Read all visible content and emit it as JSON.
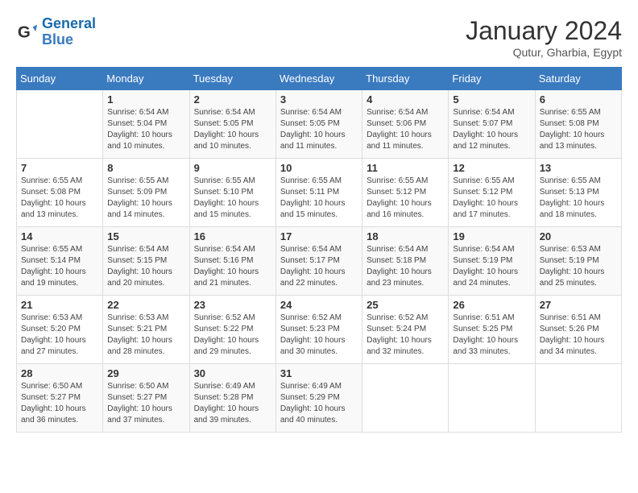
{
  "header": {
    "logo_line1": "General",
    "logo_line2": "Blue",
    "month": "January 2024",
    "location": "Qutur, Gharbia, Egypt"
  },
  "days_of_week": [
    "Sunday",
    "Monday",
    "Tuesday",
    "Wednesday",
    "Thursday",
    "Friday",
    "Saturday"
  ],
  "weeks": [
    [
      {
        "day": "",
        "sunrise": "",
        "sunset": "",
        "daylight": ""
      },
      {
        "day": "1",
        "sunrise": "Sunrise: 6:54 AM",
        "sunset": "Sunset: 5:04 PM",
        "daylight": "Daylight: 10 hours and 10 minutes."
      },
      {
        "day": "2",
        "sunrise": "Sunrise: 6:54 AM",
        "sunset": "Sunset: 5:05 PM",
        "daylight": "Daylight: 10 hours and 10 minutes."
      },
      {
        "day": "3",
        "sunrise": "Sunrise: 6:54 AM",
        "sunset": "Sunset: 5:05 PM",
        "daylight": "Daylight: 10 hours and 11 minutes."
      },
      {
        "day": "4",
        "sunrise": "Sunrise: 6:54 AM",
        "sunset": "Sunset: 5:06 PM",
        "daylight": "Daylight: 10 hours and 11 minutes."
      },
      {
        "day": "5",
        "sunrise": "Sunrise: 6:54 AM",
        "sunset": "Sunset: 5:07 PM",
        "daylight": "Daylight: 10 hours and 12 minutes."
      },
      {
        "day": "6",
        "sunrise": "Sunrise: 6:55 AM",
        "sunset": "Sunset: 5:08 PM",
        "daylight": "Daylight: 10 hours and 13 minutes."
      }
    ],
    [
      {
        "day": "7",
        "sunrise": "Sunrise: 6:55 AM",
        "sunset": "Sunset: 5:08 PM",
        "daylight": "Daylight: 10 hours and 13 minutes."
      },
      {
        "day": "8",
        "sunrise": "Sunrise: 6:55 AM",
        "sunset": "Sunset: 5:09 PM",
        "daylight": "Daylight: 10 hours and 14 minutes."
      },
      {
        "day": "9",
        "sunrise": "Sunrise: 6:55 AM",
        "sunset": "Sunset: 5:10 PM",
        "daylight": "Daylight: 10 hours and 15 minutes."
      },
      {
        "day": "10",
        "sunrise": "Sunrise: 6:55 AM",
        "sunset": "Sunset: 5:11 PM",
        "daylight": "Daylight: 10 hours and 15 minutes."
      },
      {
        "day": "11",
        "sunrise": "Sunrise: 6:55 AM",
        "sunset": "Sunset: 5:12 PM",
        "daylight": "Daylight: 10 hours and 16 minutes."
      },
      {
        "day": "12",
        "sunrise": "Sunrise: 6:55 AM",
        "sunset": "Sunset: 5:12 PM",
        "daylight": "Daylight: 10 hours and 17 minutes."
      },
      {
        "day": "13",
        "sunrise": "Sunrise: 6:55 AM",
        "sunset": "Sunset: 5:13 PM",
        "daylight": "Daylight: 10 hours and 18 minutes."
      }
    ],
    [
      {
        "day": "14",
        "sunrise": "Sunrise: 6:55 AM",
        "sunset": "Sunset: 5:14 PM",
        "daylight": "Daylight: 10 hours and 19 minutes."
      },
      {
        "day": "15",
        "sunrise": "Sunrise: 6:54 AM",
        "sunset": "Sunset: 5:15 PM",
        "daylight": "Daylight: 10 hours and 20 minutes."
      },
      {
        "day": "16",
        "sunrise": "Sunrise: 6:54 AM",
        "sunset": "Sunset: 5:16 PM",
        "daylight": "Daylight: 10 hours and 21 minutes."
      },
      {
        "day": "17",
        "sunrise": "Sunrise: 6:54 AM",
        "sunset": "Sunset: 5:17 PM",
        "daylight": "Daylight: 10 hours and 22 minutes."
      },
      {
        "day": "18",
        "sunrise": "Sunrise: 6:54 AM",
        "sunset": "Sunset: 5:18 PM",
        "daylight": "Daylight: 10 hours and 23 minutes."
      },
      {
        "day": "19",
        "sunrise": "Sunrise: 6:54 AM",
        "sunset": "Sunset: 5:19 PM",
        "daylight": "Daylight: 10 hours and 24 minutes."
      },
      {
        "day": "20",
        "sunrise": "Sunrise: 6:53 AM",
        "sunset": "Sunset: 5:19 PM",
        "daylight": "Daylight: 10 hours and 25 minutes."
      }
    ],
    [
      {
        "day": "21",
        "sunrise": "Sunrise: 6:53 AM",
        "sunset": "Sunset: 5:20 PM",
        "daylight": "Daylight: 10 hours and 27 minutes."
      },
      {
        "day": "22",
        "sunrise": "Sunrise: 6:53 AM",
        "sunset": "Sunset: 5:21 PM",
        "daylight": "Daylight: 10 hours and 28 minutes."
      },
      {
        "day": "23",
        "sunrise": "Sunrise: 6:52 AM",
        "sunset": "Sunset: 5:22 PM",
        "daylight": "Daylight: 10 hours and 29 minutes."
      },
      {
        "day": "24",
        "sunrise": "Sunrise: 6:52 AM",
        "sunset": "Sunset: 5:23 PM",
        "daylight": "Daylight: 10 hours and 30 minutes."
      },
      {
        "day": "25",
        "sunrise": "Sunrise: 6:52 AM",
        "sunset": "Sunset: 5:24 PM",
        "daylight": "Daylight: 10 hours and 32 minutes."
      },
      {
        "day": "26",
        "sunrise": "Sunrise: 6:51 AM",
        "sunset": "Sunset: 5:25 PM",
        "daylight": "Daylight: 10 hours and 33 minutes."
      },
      {
        "day": "27",
        "sunrise": "Sunrise: 6:51 AM",
        "sunset": "Sunset: 5:26 PM",
        "daylight": "Daylight: 10 hours and 34 minutes."
      }
    ],
    [
      {
        "day": "28",
        "sunrise": "Sunrise: 6:50 AM",
        "sunset": "Sunset: 5:27 PM",
        "daylight": "Daylight: 10 hours and 36 minutes."
      },
      {
        "day": "29",
        "sunrise": "Sunrise: 6:50 AM",
        "sunset": "Sunset: 5:27 PM",
        "daylight": "Daylight: 10 hours and 37 minutes."
      },
      {
        "day": "30",
        "sunrise": "Sunrise: 6:49 AM",
        "sunset": "Sunset: 5:28 PM",
        "daylight": "Daylight: 10 hours and 39 minutes."
      },
      {
        "day": "31",
        "sunrise": "Sunrise: 6:49 AM",
        "sunset": "Sunset: 5:29 PM",
        "daylight": "Daylight: 10 hours and 40 minutes."
      },
      {
        "day": "",
        "sunrise": "",
        "sunset": "",
        "daylight": ""
      },
      {
        "day": "",
        "sunrise": "",
        "sunset": "",
        "daylight": ""
      },
      {
        "day": "",
        "sunrise": "",
        "sunset": "",
        "daylight": ""
      }
    ]
  ]
}
